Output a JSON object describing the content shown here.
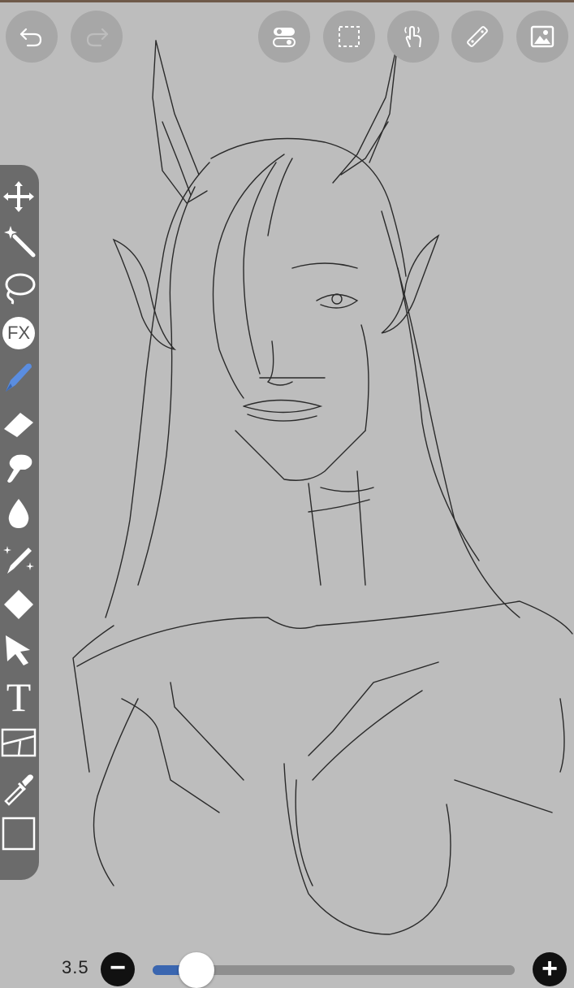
{
  "app": {
    "background_color": "#bdbdbd",
    "toolbar_color": "#6b6b6b",
    "accent_color": "#3a66b0"
  },
  "top_buttons": [
    {
      "name": "undo-button",
      "icon": "undo-icon",
      "enabled": true
    },
    {
      "name": "redo-button",
      "icon": "redo-icon",
      "enabled": false
    },
    {
      "name": "toggle-button",
      "icon": "toggle-icon",
      "enabled": true
    },
    {
      "name": "selection-button",
      "icon": "selection-icon",
      "enabled": true
    },
    {
      "name": "gesture-button",
      "icon": "hand-gesture-icon",
      "enabled": true
    },
    {
      "name": "ruler-button",
      "icon": "ruler-icon",
      "enabled": true
    },
    {
      "name": "image-button",
      "icon": "image-icon",
      "enabled": true
    }
  ],
  "tools": [
    {
      "name": "move",
      "icon": "move-icon"
    },
    {
      "name": "magic-wand",
      "icon": "magic-wand-icon"
    },
    {
      "name": "lasso",
      "icon": "lasso-icon"
    },
    {
      "name": "fx",
      "icon": "fx-icon",
      "label": "FX"
    },
    {
      "name": "brush",
      "icon": "brush-icon",
      "active": true
    },
    {
      "name": "eraser",
      "icon": "eraser-icon"
    },
    {
      "name": "smudge",
      "icon": "smudge-icon"
    },
    {
      "name": "blur",
      "icon": "blur-drop-icon"
    },
    {
      "name": "sparkle-brush",
      "icon": "sparkle-pen-icon"
    },
    {
      "name": "fill",
      "icon": "fill-diamond-icon"
    },
    {
      "name": "select",
      "icon": "arrow-cursor-icon"
    },
    {
      "name": "text",
      "icon": "text-icon",
      "label": "T"
    },
    {
      "name": "frame-divider",
      "icon": "frame-icon"
    },
    {
      "name": "eyedropper",
      "icon": "eyedropper-icon"
    },
    {
      "name": "canvas",
      "icon": "canvas-square-icon"
    }
  ],
  "brush_size": {
    "label": "3.5",
    "minus": "−",
    "plus": "+",
    "slider_fraction": 0.12
  }
}
